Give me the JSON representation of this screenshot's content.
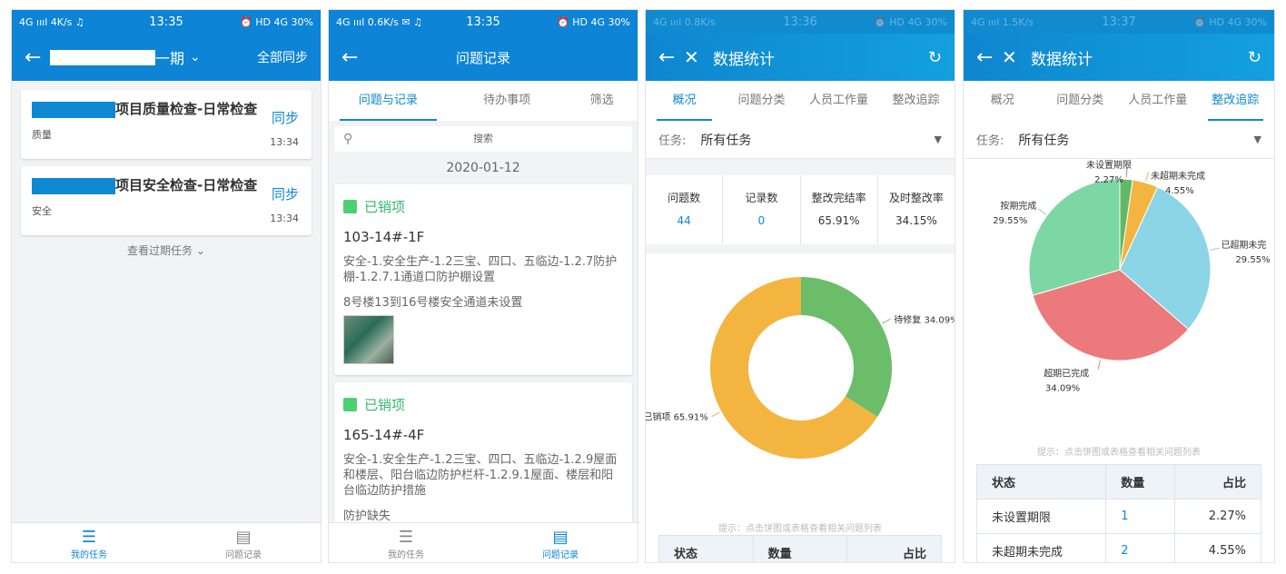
{
  "screen1": {
    "status": {
      "left": "4G ıııl  4K/s ♫",
      "time": "13:35",
      "right": "⏰ HD 4G 30%"
    },
    "header": {
      "title_suffix": "一期",
      "sync_all": "全部同步"
    },
    "tasks": [
      {
        "title": "项目质量检查-日常检查",
        "category": "质量",
        "action": "同步",
        "time": "13:34"
      },
      {
        "title": "项目安全检查-日常检查",
        "category": "安全",
        "action": "同步",
        "time": "13:34"
      }
    ],
    "expired_link": "查看过期任务",
    "tabs": [
      {
        "label": "我的任务"
      },
      {
        "label": "问题记录"
      }
    ]
  },
  "screen2": {
    "status": {
      "left": "4G ıııl  0.6K/s ✉ ♫",
      "time": "13:35",
      "right": "⏰ HD 4G 30%"
    },
    "header": {
      "title": "问题记录"
    },
    "top_tabs": [
      {
        "label": "问题与记录"
      },
      {
        "label": "待办事项"
      },
      {
        "label": "筛选"
      }
    ],
    "search_placeholder": "搜索",
    "date": "2020-01-12",
    "records": [
      {
        "status": "已销项",
        "code": "103-14#-1F",
        "desc": "安全-1.安全生产-1.2三宝、四口、五临边-1.2.7防护棚-1.2.7.1通道口防护棚设置",
        "note": "8号楼13到16号楼安全通道未设置"
      },
      {
        "status": "已销项",
        "code": "165-14#-4F",
        "desc": "安全-1.安全生产-1.2三宝、四口、五临边-1.2.9屋面和楼层、阳台临边防护栏杆-1.2.9.1屋面、楼层和阳台临边防护措施",
        "note": "防护缺失"
      }
    ],
    "tabs": [
      {
        "label": "我的任务"
      },
      {
        "label": "问题记录"
      }
    ]
  },
  "screen3": {
    "status": {
      "left": "4G ıııl  0.8K/s",
      "time": "13:36",
      "right": "⏰ HD 4G 30%"
    },
    "header": {
      "title": "数据统计"
    },
    "top_tabs": [
      {
        "label": "概况"
      },
      {
        "label": "问题分类"
      },
      {
        "label": "人员工作量"
      },
      {
        "label": "整改追踪"
      }
    ],
    "task_label": "任务:",
    "task_value": "所有任务",
    "stats": [
      {
        "label": "问题数",
        "value": "44"
      },
      {
        "label": "记录数",
        "value": "0"
      },
      {
        "label": "整改完结率",
        "value": "65.91%"
      },
      {
        "label": "及时整改率",
        "value": "34.15%"
      }
    ],
    "chart_data": {
      "type": "pie",
      "categories": [
        "待修复",
        "已销项"
      ],
      "values": [
        34.09,
        65.91
      ],
      "labels": [
        "待修复 34.09%",
        "已销项 65.91%"
      ],
      "colors": [
        "#6cbd6a",
        "#f3b53f"
      ]
    },
    "hint": "提示：点击饼图或表格查看相关问题列表",
    "table_headers": [
      "状态",
      "数量",
      "占比"
    ]
  },
  "screen4": {
    "status": {
      "left": "4G ıııl  1.5K/s",
      "time": "13:37",
      "right": "⏰ HD 4G 30%"
    },
    "header": {
      "title": "数据统计"
    },
    "top_tabs": [
      {
        "label": "概况"
      },
      {
        "label": "问题分类"
      },
      {
        "label": "人员工作量"
      },
      {
        "label": "整改追踪"
      }
    ],
    "task_label": "任务:",
    "task_value": "所有任务",
    "chart_data": {
      "type": "pie",
      "categories": [
        "未设置期限",
        "未超期未完成",
        "已超期未完成",
        "超期已完成",
        "按期完成"
      ],
      "values": [
        2.27,
        4.55,
        29.55,
        34.09,
        29.55
      ],
      "name_labels": [
        "未设置期限",
        "未超期未完成",
        "已超期未完",
        "超期已完成",
        "按期完成"
      ],
      "value_labels": [
        "2.27%",
        "4.55%",
        "29.55%",
        "34.09%",
        "29.55%"
      ],
      "colors": [
        "#63b866",
        "#f3b53f",
        "#8bd5e6",
        "#ec7a7c",
        "#7dd7a4"
      ]
    },
    "hint": "提示：点击饼图或表格查看相关问题列表",
    "table_headers": [
      "状态",
      "数量",
      "占比"
    ],
    "table_rows": [
      {
        "status": "未设置期限",
        "count": "1",
        "ratio": "2.27%"
      },
      {
        "status": "未超期未完成",
        "count": "2",
        "ratio": "4.55%"
      }
    ]
  }
}
